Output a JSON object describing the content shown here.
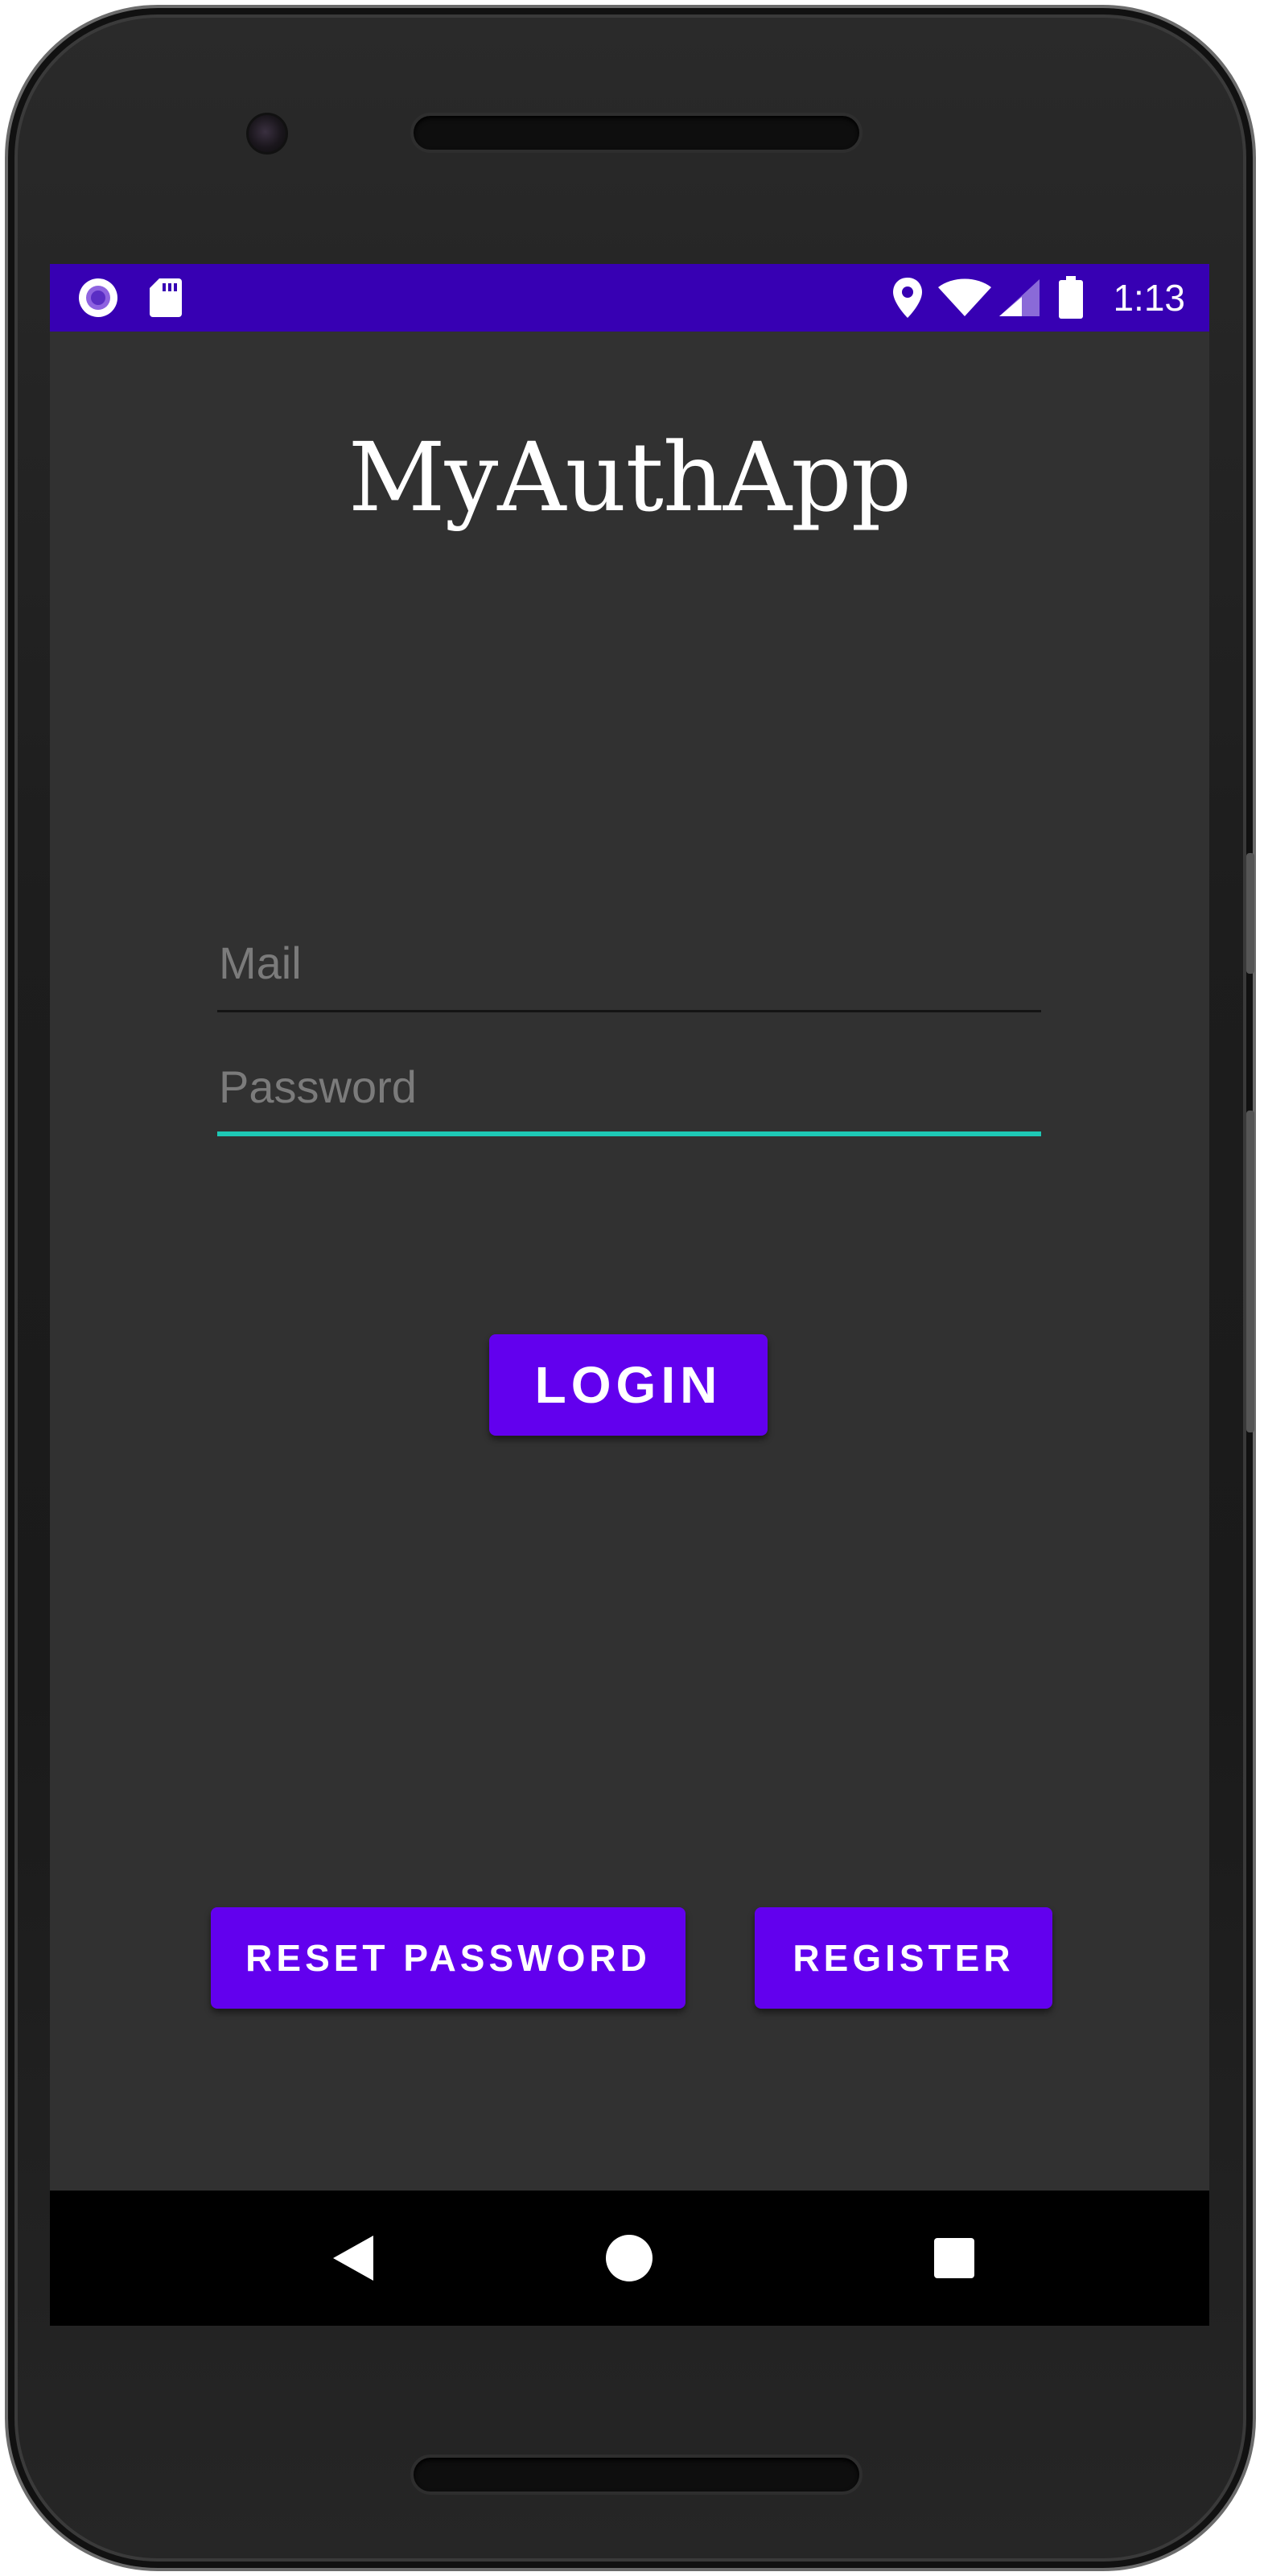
{
  "status_bar": {
    "time": "1:13",
    "background_color": "#3700b3",
    "left_icons": [
      "notification-circle-icon",
      "sd-card-icon"
    ],
    "right_icons": [
      "location-pin-icon",
      "wifi-icon",
      "cell-signal-icon",
      "battery-icon"
    ]
  },
  "app": {
    "title": "MyAuthApp"
  },
  "form": {
    "mail_placeholder": "Mail",
    "mail_value": "",
    "password_placeholder": "Password",
    "password_value": "",
    "focused_field": "password",
    "focus_color": "#1ec8b5"
  },
  "buttons": {
    "login_label": "LOGIN",
    "reset_password_label": "RESET PASSWORD",
    "register_label": "REGISTER",
    "accent_color": "#6200ee"
  },
  "navigation": {
    "items": [
      "back-icon",
      "home-icon",
      "recents-icon"
    ]
  }
}
